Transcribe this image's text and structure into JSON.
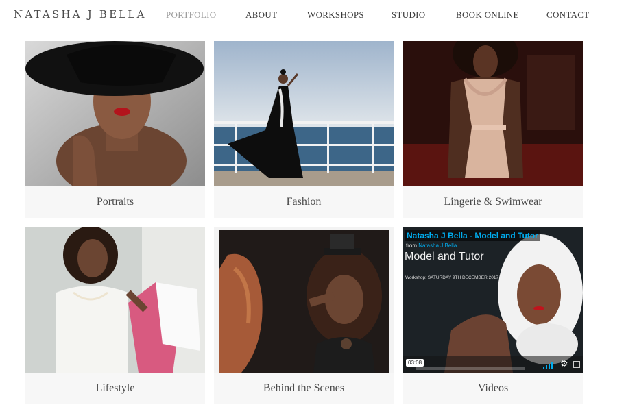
{
  "brand": {
    "name": "NATASHA J BELLA"
  },
  "nav": {
    "items": [
      {
        "label": "PORTFOLIO",
        "active": true
      },
      {
        "label": "ABOUT",
        "active": false
      },
      {
        "label": "WORKSHOPS",
        "active": false
      },
      {
        "label": "STUDIO",
        "active": false
      },
      {
        "label": "BOOK ONLINE",
        "active": false
      },
      {
        "label": "CONTACT",
        "active": false
      }
    ]
  },
  "gallery": {
    "tiles": [
      {
        "caption": "Portraits"
      },
      {
        "caption": "Fashion"
      },
      {
        "caption": "Lingerie & Swimwear"
      },
      {
        "caption": "Lifestyle"
      },
      {
        "caption": "Behind the Scenes"
      },
      {
        "caption": "Videos"
      }
    ]
  },
  "video": {
    "title": "Natasha J Bella - Model and Tutor",
    "from_prefix": "from",
    "from_name": "Natasha J Bella",
    "subtitle": "Model and Tutor",
    "workshop_line": "Workshop: SATURDAY 9TH DECEMBER 2017",
    "duration": "03:08",
    "settings_icon": "gear-icon",
    "volume_icon": "volume-bars-icon"
  },
  "colors": {
    "nav_active": "#9a9a9a",
    "caption_bg": "#f7f7f7",
    "video_accent": "#00adef"
  }
}
